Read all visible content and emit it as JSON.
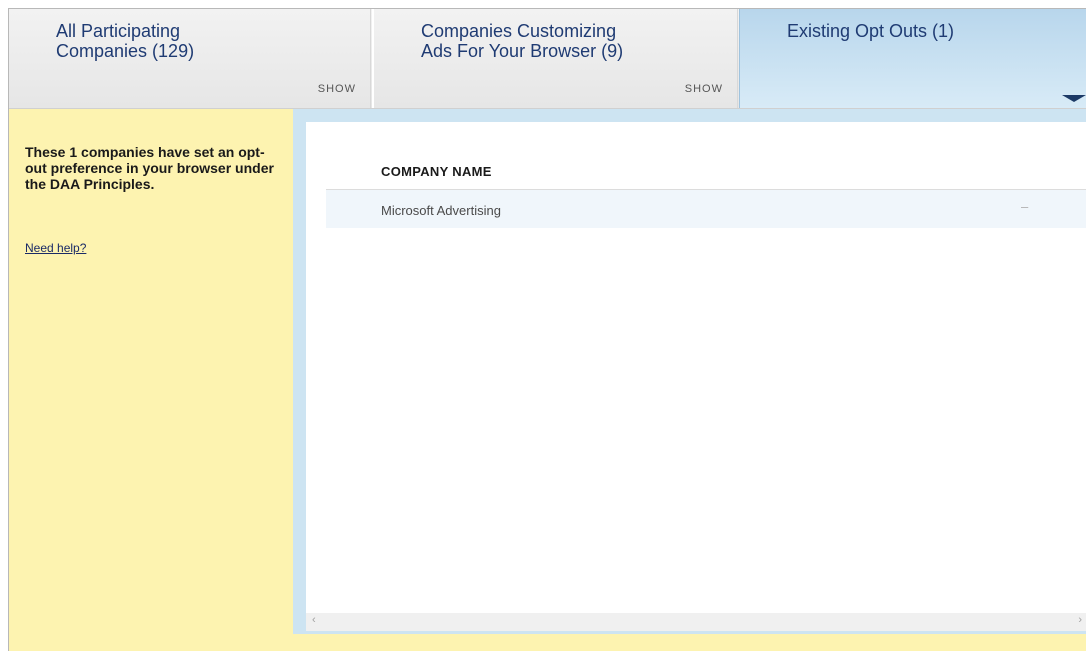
{
  "tabs": [
    {
      "label": "All Participating\nCompanies (129)",
      "show": "SHOW"
    },
    {
      "label": "Companies Customizing\nAds For Your Browser (9)",
      "show": "SHOW"
    },
    {
      "label": "Existing Opt Outs (1)"
    }
  ],
  "sidebar": {
    "message": "These 1 companies have set an opt-out preference in your browser under the DAA Principles.",
    "help_link": "Need help?"
  },
  "table": {
    "column_header": "COMPANY NAME",
    "rows": [
      {
        "name": "Microsoft Advertising",
        "status": "–"
      }
    ]
  },
  "scrollbar": {
    "left_arrow": "‹",
    "right_arrow": "›"
  },
  "colors": {
    "tab_text": "#1f3b73",
    "active_tab": "#b8d6ec",
    "sidebar_bg": "#fdf3b0",
    "content_border": "#cde4f2"
  }
}
